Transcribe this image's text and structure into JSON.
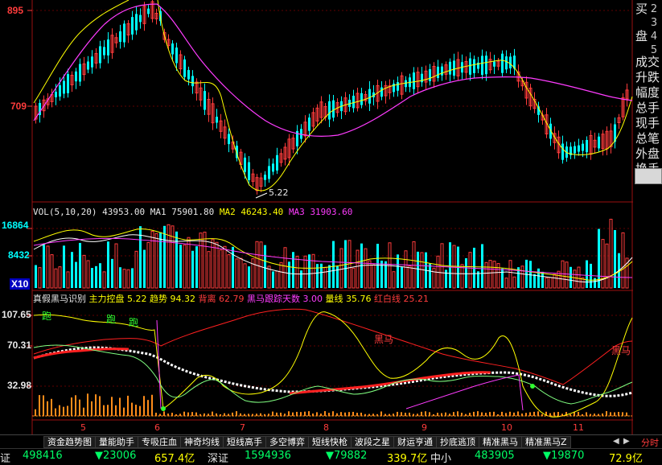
{
  "price_panel": {
    "y_high": "895",
    "y_mid": "709",
    "low_label": "5.22"
  },
  "volume_panel": {
    "title_name": "VOL(5,10,20)",
    "vol_value": "43953.00",
    "ma1_label": "MA1",
    "ma1_value": "75901.80",
    "ma2_label": "MA2",
    "ma2_value": "46243.40",
    "ma3_label": "MA3",
    "ma3_value": "31903.60",
    "y_top": "16864",
    "y_mid": "8432",
    "y_unit": "X10"
  },
  "indicator_panel": {
    "name": "真假黑马识别",
    "items": [
      {
        "label": "主力控盘",
        "value": "5.22",
        "color": "#ffff00"
      },
      {
        "label": "趋势",
        "value": "94.32",
        "color": "#ffff00"
      },
      {
        "label": "背离",
        "value": "62.79",
        "color": "#ff3c3c"
      },
      {
        "label": "黑马跟踪天数",
        "value": "3.00",
        "color": "#ff3cff"
      },
      {
        "label": "量线",
        "value": "35.76",
        "color": "#ffff00"
      },
      {
        "label": "红白线",
        "value": "25.21",
        "color": "#ff3c3c"
      }
    ],
    "y_ticks": [
      "107.65",
      "70.31",
      "32.98"
    ],
    "labels": {
      "run": "跑",
      "black_horse_1": "黑马",
      "black_horse_2": "黑马"
    }
  },
  "x_axis": [
    "5",
    "6",
    "7",
    "8",
    "9",
    "10",
    "11"
  ],
  "side_panel": {
    "buy_label": "买",
    "buy_label2": "盘",
    "digits": "2345",
    "rows": [
      "成交",
      "升跌",
      "幅度",
      "总手",
      "现手",
      "总笔",
      "外盘",
      "换手"
    ]
  },
  "tabs": [
    "资金趋势图",
    "量能助手",
    "专吸庄血",
    "神奇均线",
    "短线高手",
    "多空博弈",
    "短线快枪",
    "波段之星",
    "财运亨通",
    "抄底逃顶",
    "精准黑马",
    "精准黑马Z"
  ],
  "tab_right": "分时",
  "status_bar": {
    "left_cut": "证",
    "sh_index": "498416",
    "sh_change": "▼23006",
    "sh_amount": "657.4亿",
    "sz_label": "深证",
    "sz_index": "1594936",
    "sz_change": "▼79882",
    "sz_amount": "339.7亿",
    "zx_label": "中小",
    "zx_index": "483905",
    "zx_change": "▼19870",
    "zx_amount": "72.9亿"
  },
  "colors": {
    "up": "#ff3c3c",
    "down": "#00ffff",
    "ma_yellow": "#ffff00",
    "ma_magenta": "#ff3cff",
    "ma_white": "#ffffff"
  }
}
